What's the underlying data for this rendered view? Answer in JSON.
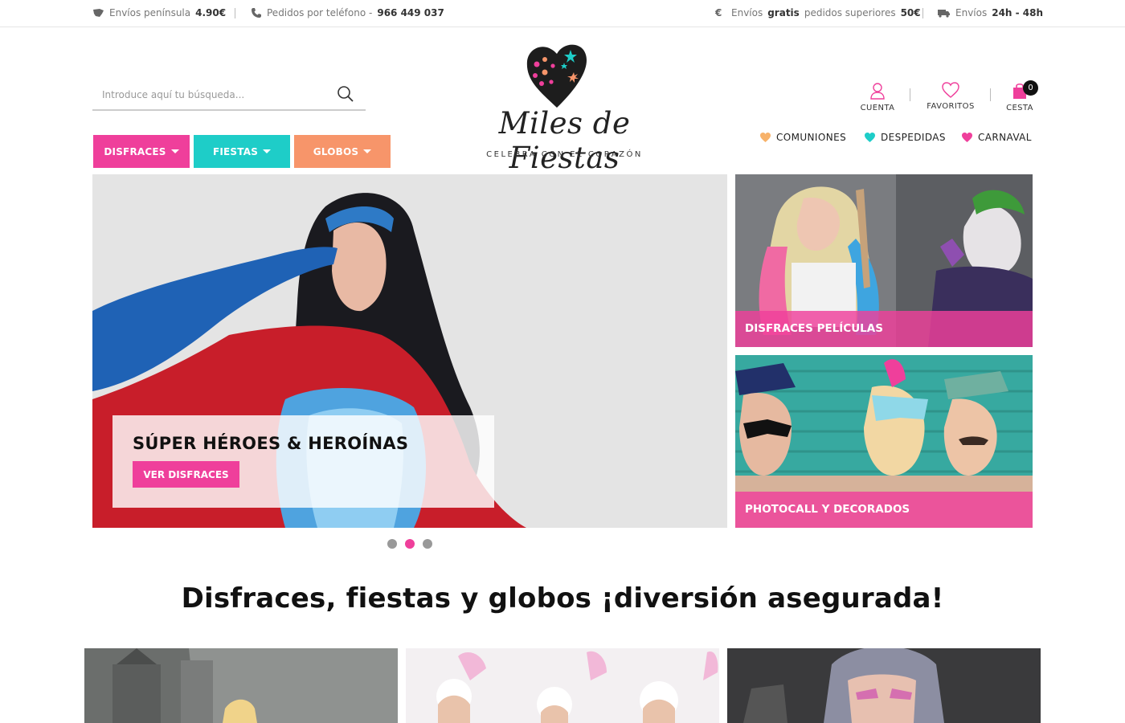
{
  "topbar": {
    "shipping_prefix": "Envíos península",
    "shipping_price": "4.90€",
    "phone_prefix": "Pedidos por teléfono -",
    "phone_number": "966 449 037",
    "free_prefix": "Envíos",
    "free_bold": "gratis",
    "free_mid": "pedidos superiores",
    "free_amount": "50€",
    "delivery_prefix": "Envíos",
    "delivery_time": "24h - 48h"
  },
  "search": {
    "placeholder": "Introduce aquí tu búsqueda..."
  },
  "categories": [
    {
      "label": "DISFRACES",
      "color": "#ef3f9b"
    },
    {
      "label": "FIESTAS",
      "color": "#1ecdc8"
    },
    {
      "label": "GLOBOS",
      "color": "#f7956a"
    }
  ],
  "logo": {
    "name": "Miles de Fiestas",
    "tagline": "CELEBRA CON EL CORAZÓN"
  },
  "user_actions": {
    "account": "CUENTA",
    "favorites": "FAVORITOS",
    "cart": "CESTA",
    "cart_count": "0"
  },
  "occasions": [
    {
      "label": "COMUNIONES",
      "color": "#f7b26a"
    },
    {
      "label": "DESPEDIDAS",
      "color": "#1ecdc8"
    },
    {
      "label": "CARNAVAL",
      "color": "#ef3f9b"
    }
  ],
  "hero": {
    "title": "SÚPER HÉROES & HEROÍNAS",
    "button": "VER DISFRACES",
    "slide_count": 3,
    "active_slide": 2
  },
  "tiles": [
    {
      "label": "DISFRACES PELÍCULAS"
    },
    {
      "label": "PHOTOCALL Y DECORADOS"
    }
  ],
  "heading": "Disfraces, fiestas y globos ¡diversión asegurada!",
  "colors": {
    "pink": "#ef3f9b",
    "teal": "#1ecdc8",
    "orange": "#f7956a"
  }
}
